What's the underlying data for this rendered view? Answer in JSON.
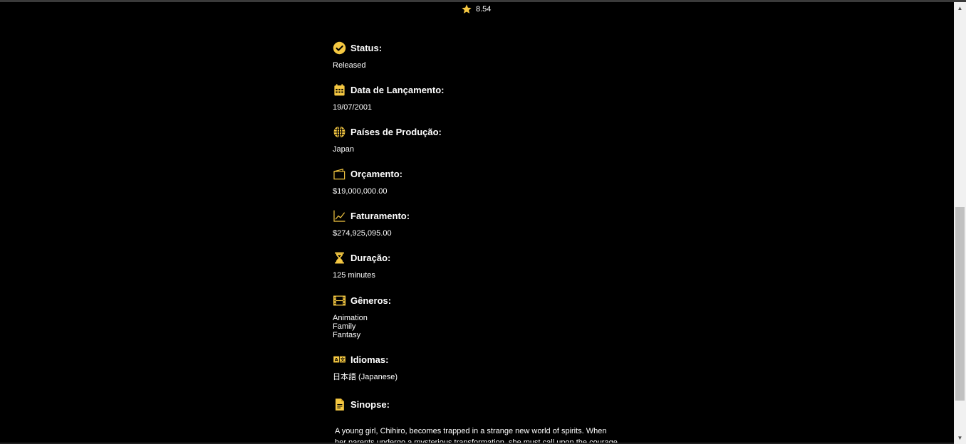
{
  "rating": {
    "value": "8.54",
    "icon": "star-icon"
  },
  "accent_color": "#f5c842",
  "details": {
    "status": {
      "label": "Status:",
      "value": "Released",
      "icon": "check-circle-icon"
    },
    "release_date": {
      "label": "Data de Lançamento:",
      "value": "19/07/2001",
      "icon": "calendar-icon"
    },
    "countries": {
      "label": "Países de Produção:",
      "value": "Japan",
      "icon": "globe-icon"
    },
    "budget": {
      "label": "Orçamento:",
      "value": "$19,000,000.00",
      "icon": "wallet-icon"
    },
    "revenue": {
      "label": "Faturamento:",
      "value": "$274,925,095.00",
      "icon": "chart-line-icon"
    },
    "runtime": {
      "label": "Duração:",
      "value": "125 minutes",
      "icon": "hourglass-icon"
    },
    "genres": {
      "label": "Gêneros:",
      "items": [
        "Animation",
        "Family",
        "Fantasy"
      ],
      "icon": "film-icon"
    },
    "languages": {
      "label": "Idiomas:",
      "value": "日本語 (Japanese)",
      "icon": "translate-icon"
    },
    "synopsis": {
      "label": "Sinopse:",
      "icon": "document-icon",
      "text": "A young girl, Chihiro, becomes trapped in a strange new world of spirits. When her parents undergo a mysterious transformation, she must call upon the courage she"
    }
  }
}
